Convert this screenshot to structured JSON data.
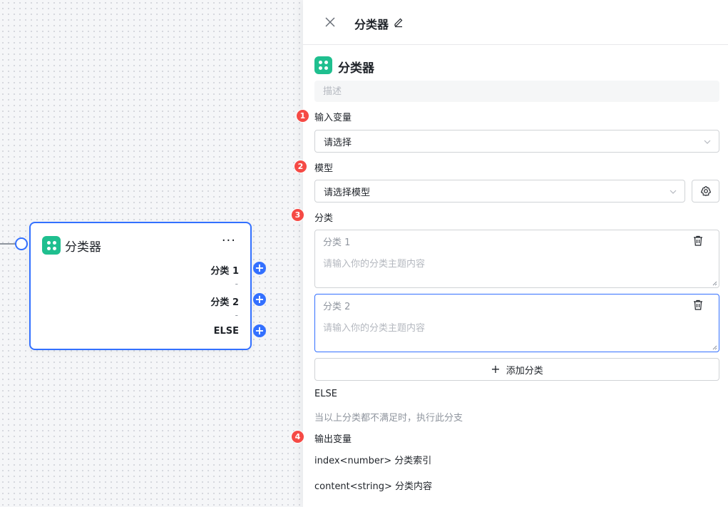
{
  "canvas": {
    "node": {
      "title": "分类器",
      "more": "···",
      "branches": [
        "分类 1",
        "分类 2",
        "ELSE"
      ],
      "separator": "-"
    }
  },
  "panel": {
    "title": "分类器",
    "node_name": "分类器",
    "description_placeholder": "描述",
    "sections": {
      "input_var": {
        "step": "1",
        "label": "输入变量",
        "placeholder": "请选择"
      },
      "model": {
        "step": "2",
        "label": "模型",
        "placeholder": "请选择模型"
      },
      "categories": {
        "step": "3",
        "label": "分类",
        "items": [
          {
            "name": "分类 1",
            "placeholder": "请输入你的分类主题内容"
          },
          {
            "name": "分类 2",
            "placeholder": "请输入你的分类主题内容"
          }
        ],
        "add_label": "添加分类"
      },
      "else": {
        "label": "ELSE",
        "hint": "当以上分类都不满足时，执行此分支"
      },
      "output": {
        "step": "4",
        "label": "输出变量",
        "vars": [
          "index<number> 分类索引",
          "content<string> 分类内容"
        ]
      }
    }
  },
  "colors": {
    "accent": "#3370ff",
    "node_icon": "#1fbf8f",
    "step_badge": "#f54a45"
  }
}
